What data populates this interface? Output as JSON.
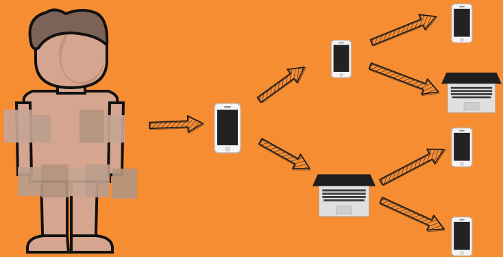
{
  "scene": {
    "background_color": "#F78D33",
    "figure": {
      "skin_color": "#D6A590",
      "hair_color": "#7D6258",
      "outline_color": "#111111",
      "censor_colors": [
        "#C7A594",
        "#BC9D8C",
        "#B39480"
      ]
    },
    "devices": [
      {
        "type": "phone",
        "name": "phone-center",
        "generation": 1
      },
      {
        "type": "phone",
        "name": "phone-top",
        "generation": 2
      },
      {
        "type": "laptop",
        "name": "laptop-center",
        "generation": 2
      },
      {
        "type": "phone",
        "name": "phone-far-top",
        "generation": 3
      },
      {
        "type": "laptop",
        "name": "laptop-far-upper",
        "generation": 3
      },
      {
        "type": "phone",
        "name": "phone-far-lower",
        "generation": 3
      },
      {
        "type": "phone",
        "name": "phone-far-bottom",
        "generation": 3
      }
    ],
    "arrows": [
      {
        "name": "arrow-person-to-phone",
        "from": "person",
        "to": "phone-center"
      },
      {
        "name": "arrow-phone-to-phone-top",
        "from": "phone-center",
        "to": "phone-top"
      },
      {
        "name": "arrow-phone-to-laptop",
        "from": "phone-center",
        "to": "laptop-center"
      },
      {
        "name": "arrow-phone-top-to-phone-far-top",
        "from": "phone-top",
        "to": "phone-far-top"
      },
      {
        "name": "arrow-phone-top-to-laptop-far",
        "from": "phone-top",
        "to": "laptop-far-upper"
      },
      {
        "name": "arrow-laptop-to-phone-far-lower",
        "from": "laptop-center",
        "to": "phone-far-lower"
      },
      {
        "name": "arrow-laptop-to-phone-far-bottom",
        "from": "laptop-center",
        "to": "phone-far-bottom"
      }
    ]
  }
}
